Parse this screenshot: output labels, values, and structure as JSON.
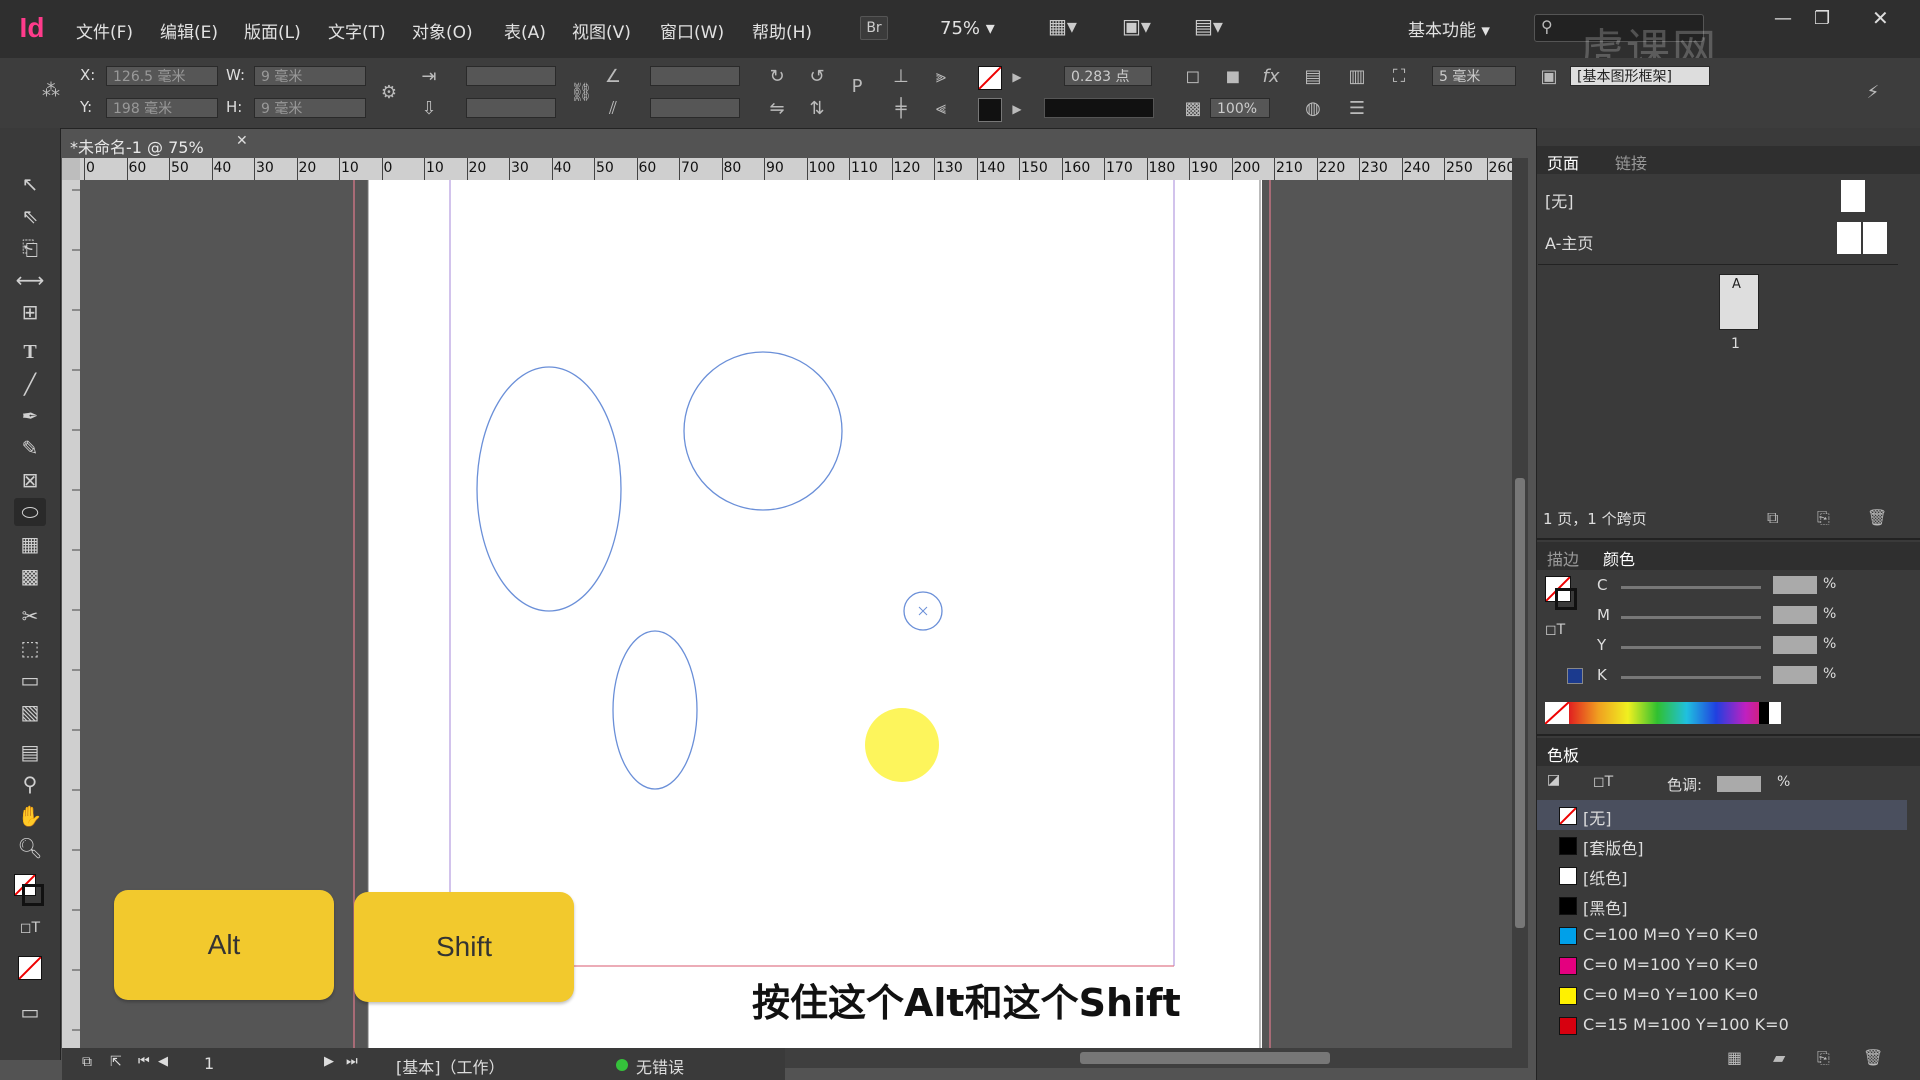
{
  "app": {
    "logo": "Id",
    "menus": [
      "文件(F)",
      "编辑(E)",
      "版面(L)",
      "文字(T)",
      "对象(O)",
      "表(A)",
      "视图(V)",
      "窗口(W)",
      "帮助(H)"
    ],
    "bridge_label": "Br",
    "zoom": "75%",
    "workspace": "基本功能",
    "watermark": "虎课网"
  },
  "control": {
    "x_label": "X:",
    "x_value": "126.5 毫米",
    "y_label": "Y:",
    "y_value": "198 毫米",
    "w_label": "W:",
    "w_value": "9 毫米",
    "h_label": "H:",
    "h_value": "9 毫米",
    "stroke_weight": "0.283 点",
    "opacity": "100%",
    "spacing": "5 毫米",
    "frame_type": "[基本图形框架]"
  },
  "document": {
    "tab_title": "*未命名-1 @ 75%",
    "ruler_h": [
      "0",
      "60",
      "50",
      "40",
      "30",
      "20",
      "10",
      "0",
      "10",
      "20",
      "30",
      "40",
      "50",
      "60",
      "70",
      "80",
      "90",
      "100",
      "110",
      "120",
      "130",
      "140",
      "150",
      "160",
      "170",
      "180",
      "190",
      "200",
      "210",
      "220",
      "230",
      "240",
      "250",
      "260"
    ]
  },
  "status": {
    "page_number": "1",
    "preflight_profile": "[基本]（工作）",
    "errors": "无错误"
  },
  "pages_panel": {
    "tabs": [
      "页面",
      "链接"
    ],
    "none_master": "[无]",
    "a_master": "A-主页",
    "page_thumb_master": "A",
    "page_thumb_number": "1",
    "summary": "1 页，1 个跨页"
  },
  "color_panel": {
    "tabs": [
      "描边",
      "颜色"
    ],
    "channels": [
      "C",
      "M",
      "Y",
      "K"
    ],
    "percent_symbol": "%"
  },
  "swatches_panel": {
    "title": "色板",
    "tint_label": "色调:",
    "percent_symbol": "%",
    "items": [
      {
        "label": "[无]",
        "color": "#ffffff"
      },
      {
        "label": "[套版色]",
        "color": "#000000"
      },
      {
        "label": "[纸色]",
        "color": "#ffffff"
      },
      {
        "label": "[黑色]",
        "color": "#000000"
      },
      {
        "label": "C=100 M=0 Y=0 K=0",
        "color": "#00a0e9"
      },
      {
        "label": "C=0 M=100 Y=0 K=0",
        "color": "#e4007f"
      },
      {
        "label": "C=0 M=0 Y=100 K=0",
        "color": "#fff100"
      },
      {
        "label": "C=15 M=100 Y=100 K=0",
        "color": "#d7000f"
      }
    ]
  },
  "overlay": {
    "keys": [
      "Alt",
      "Shift"
    ],
    "subtitle": "按住这个Alt和这个Shift",
    "key_color": "#f2c92d"
  },
  "colors": {
    "ellipse_stroke": "#6a8fd8",
    "filled_circle": "#fdf55c"
  }
}
